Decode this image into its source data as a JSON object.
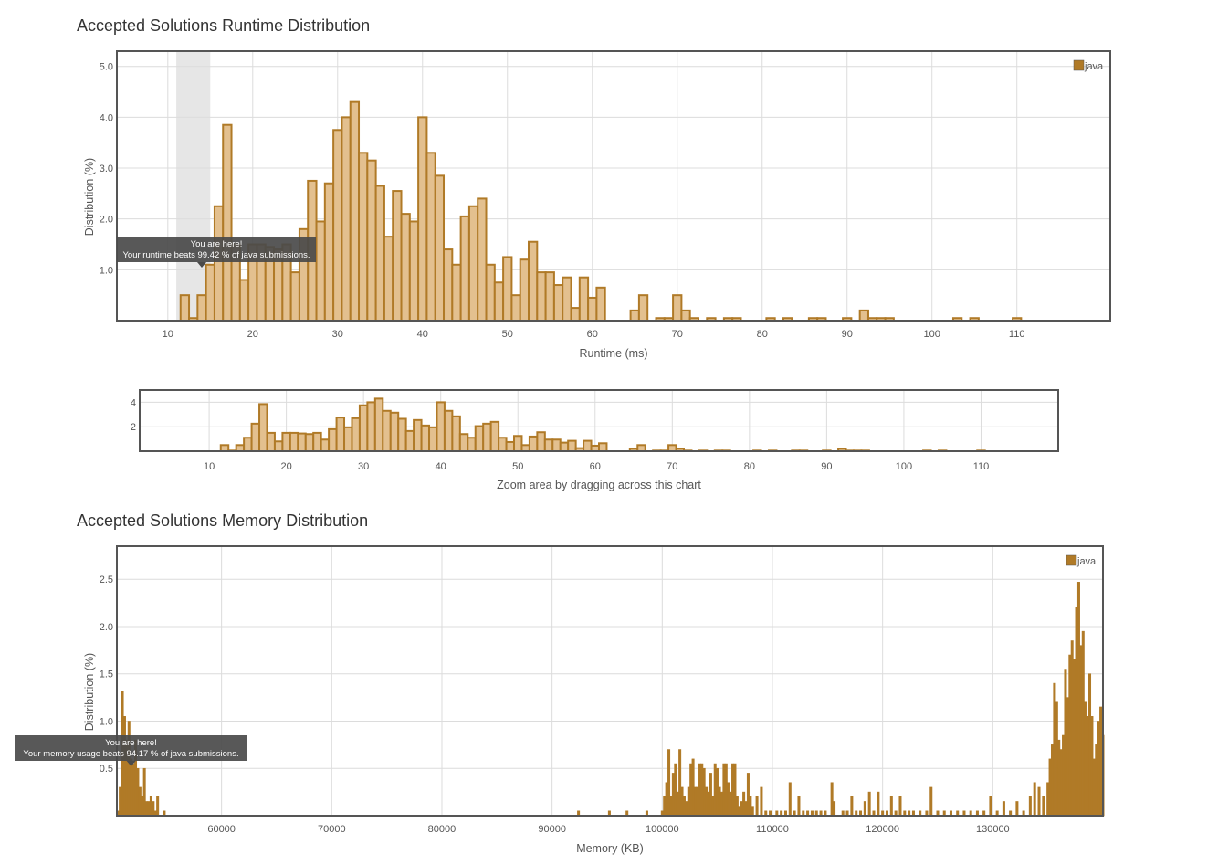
{
  "runtime_title": "Accepted Solutions Runtime Distribution",
  "memory_title": "Accepted Solutions Memory Distribution",
  "zoom_caption": "Zoom area by dragging across this chart",
  "colors": {
    "bar_fill": "#e3c08f",
    "bar_stroke": "#b07a27",
    "memory_fill": "#b07a27",
    "grid": "#dcdcdc",
    "frame": "#555555",
    "highlight": "#e6e6e6",
    "tooltip_bg": "#4a4a4a"
  },
  "chart_data": [
    {
      "id": "runtime",
      "type": "bar",
      "title": "Accepted Solutions Runtime Distribution",
      "xlabel": "Runtime (ms)",
      "ylabel": "Distribution (%)",
      "xlim": [
        4,
        121
      ],
      "ylim": [
        0,
        5.3
      ],
      "xticks": [
        10,
        20,
        30,
        40,
        50,
        60,
        70,
        80,
        90,
        100,
        110
      ],
      "yticks": [
        1.0,
        2.0,
        3.0,
        4.0,
        5.0
      ],
      "ytick_labels": [
        "1.0",
        "2.0",
        "3.0",
        "4.0",
        "5.0"
      ],
      "bin_width": 1,
      "grid": true,
      "legend": {
        "position": "top-right",
        "entries": [
          "java"
        ]
      },
      "highlight_range": [
        11,
        15
      ],
      "tooltip": {
        "at_x": 14,
        "line1": "You are here!",
        "line2": "Your runtime beats 99.42 % of java submissions."
      },
      "x": [
        12,
        13,
        14,
        15,
        16,
        17,
        18,
        19,
        20,
        21,
        22,
        23,
        24,
        25,
        26,
        27,
        28,
        29,
        30,
        31,
        32,
        33,
        34,
        35,
        36,
        37,
        38,
        39,
        40,
        41,
        42,
        43,
        44,
        45,
        46,
        47,
        48,
        49,
        50,
        51,
        52,
        53,
        54,
        55,
        56,
        57,
        58,
        59,
        60,
        61,
        62,
        63,
        64,
        65,
        66,
        67,
        68,
        69,
        70,
        71,
        72,
        73,
        74,
        75,
        76,
        77,
        78,
        79,
        80,
        81,
        82,
        83,
        84,
        85,
        86,
        87,
        88,
        89,
        90,
        91,
        92,
        93,
        94,
        95,
        96,
        97,
        98,
        99,
        100,
        101,
        102,
        103,
        104,
        105,
        106,
        107,
        108,
        109,
        110
      ],
      "values": [
        0.5,
        0.05,
        0.5,
        1.1,
        2.25,
        3.85,
        1.5,
        0.8,
        1.5,
        1.5,
        1.45,
        1.4,
        1.5,
        0.95,
        1.8,
        2.75,
        1.95,
        2.7,
        3.75,
        4.0,
        4.3,
        3.3,
        3.15,
        2.65,
        1.65,
        2.55,
        2.1,
        1.95,
        4.0,
        3.3,
        2.85,
        1.4,
        1.1,
        2.05,
        2.25,
        2.4,
        1.1,
        0.75,
        1.25,
        0.5,
        1.2,
        1.55,
        0.95,
        0.95,
        0.7,
        0.85,
        0.25,
        0.85,
        0.45,
        0.65,
        0,
        0,
        0,
        0.2,
        0.5,
        0,
        0.05,
        0.05,
        0.5,
        0.2,
        0.05,
        0,
        0.05,
        0,
        0.05,
        0.05,
        0,
        0,
        0,
        0.05,
        0,
        0.05,
        0,
        0,
        0.05,
        0.05,
        0,
        0,
        0.05,
        0,
        0.2,
        0.05,
        0.05,
        0.05,
        0,
        0,
        0,
        0,
        0,
        0,
        0,
        0.05,
        0,
        0.05,
        0,
        0,
        0,
        0,
        0.05
      ]
    },
    {
      "id": "zoom",
      "type": "bar",
      "title": "",
      "xlabel": "",
      "ylabel": "",
      "xlim": [
        1,
        120
      ],
      "ylim": [
        0,
        5
      ],
      "xticks": [
        10,
        20,
        30,
        40,
        50,
        60,
        70,
        80,
        90,
        100,
        110
      ],
      "yticks": [
        2,
        4
      ],
      "ytick_labels": [
        "2",
        "4"
      ],
      "bin_width": 1,
      "grid": true,
      "source": "runtime"
    },
    {
      "id": "memory",
      "type": "bar",
      "title": "Accepted Solutions Memory Distribution",
      "xlabel": "Memory (KB)",
      "ylabel": "Distribution (%)",
      "xlim": [
        50500,
        140000
      ],
      "ylim": [
        0,
        2.85
      ],
      "xticks": [
        60000,
        70000,
        80000,
        90000,
        100000,
        110000,
        120000,
        130000
      ],
      "yticks": [
        0.5,
        1.0,
        1.5,
        2.0,
        2.5
      ],
      "ytick_labels": [
        "0.5",
        "1.0",
        "1.5",
        "2.0",
        "2.5"
      ],
      "bin_width": 200,
      "grid": true,
      "legend": {
        "position": "top-right",
        "entries": [
          "java"
        ]
      },
      "tooltip": {
        "at_x": 51800,
        "line1": "You are here!",
        "line2": "Your memory usage beats 94.17 % of java submissions."
      },
      "x": [
        50500,
        50700,
        50900,
        51100,
        51300,
        51500,
        51700,
        51900,
        52100,
        52300,
        52500,
        52700,
        52900,
        53100,
        53300,
        53500,
        53700,
        53900,
        54100,
        54700,
        92300,
        95100,
        96700,
        98500,
        99900,
        100100,
        100300,
        100500,
        100700,
        100900,
        101100,
        101300,
        101500,
        101700,
        101900,
        102100,
        102300,
        102500,
        102700,
        102900,
        103100,
        103300,
        103500,
        103700,
        103900,
        104100,
        104300,
        104500,
        104700,
        104900,
        105100,
        105300,
        105500,
        105700,
        105900,
        106100,
        106300,
        106500,
        106700,
        106900,
        107100,
        107300,
        107500,
        107700,
        107900,
        108100,
        108500,
        108900,
        109300,
        109700,
        110300,
        110700,
        111100,
        111500,
        111900,
        112300,
        112700,
        113100,
        113500,
        113900,
        114300,
        114700,
        115300,
        115500,
        116300,
        116700,
        117100,
        117500,
        117900,
        118300,
        118700,
        119100,
        119500,
        119900,
        120300,
        120700,
        121100,
        121500,
        121900,
        122300,
        122700,
        123300,
        123900,
        124300,
        124900,
        125500,
        126100,
        126700,
        127300,
        127900,
        128500,
        129100,
        129700,
        130300,
        130900,
        131500,
        132100,
        132700,
        133300,
        133700,
        134100,
        134500,
        134900,
        135100,
        135300,
        135500,
        135700,
        135900,
        136100,
        136300,
        136500,
        136700,
        136900,
        137100,
        137300,
        137500,
        137700,
        137900,
        138100,
        138300,
        138500,
        138700,
        138900,
        139100,
        139300,
        139500,
        139700,
        139900
      ],
      "values": [
        0.05,
        0.3,
        1.32,
        1.05,
        0.8,
        1.0,
        0.6,
        0.55,
        0.8,
        0.5,
        0.3,
        0.2,
        0.5,
        0.15,
        0.15,
        0.2,
        0.15,
        0.05,
        0.2,
        0.05,
        0.05,
        0.05,
        0.05,
        0.05,
        0.05,
        0.2,
        0.35,
        0.7,
        0.2,
        0.45,
        0.55,
        0.25,
        0.7,
        0.3,
        0.2,
        0.15,
        0.3,
        0.55,
        0.6,
        0.3,
        0.3,
        0.55,
        0.55,
        0.5,
        0.3,
        0.25,
        0.45,
        0.2,
        0.55,
        0.5,
        0.3,
        0.25,
        0.55,
        0.55,
        0.35,
        0.25,
        0.55,
        0.55,
        0.2,
        0.1,
        0.15,
        0.25,
        0.15,
        0.45,
        0.2,
        0.1,
        0.2,
        0.3,
        0.05,
        0.05,
        0.05,
        0.05,
        0.05,
        0.35,
        0.05,
        0.2,
        0.05,
        0.05,
        0.05,
        0.05,
        0.05,
        0.05,
        0.35,
        0.15,
        0.05,
        0.05,
        0.2,
        0.05,
        0.05,
        0.15,
        0.25,
        0.05,
        0.25,
        0.05,
        0.05,
        0.2,
        0.05,
        0.2,
        0.05,
        0.05,
        0.05,
        0.05,
        0.05,
        0.3,
        0.05,
        0.05,
        0.05,
        0.05,
        0.05,
        0.05,
        0.05,
        0.05,
        0.2,
        0.05,
        0.15,
        0.05,
        0.15,
        0.05,
        0.2,
        0.35,
        0.3,
        0.2,
        0.35,
        0.6,
        0.75,
        1.4,
        1.2,
        0.8,
        0.7,
        0.85,
        1.55,
        1.25,
        1.7,
        1.85,
        1.65,
        2.2,
        2.47,
        1.8,
        1.95,
        1.2,
        1.05,
        1.5,
        1.05,
        0.6,
        0.75,
        1.0,
        1.15,
        0.85,
        0.7,
        0.45,
        0.45
      ]
    }
  ]
}
